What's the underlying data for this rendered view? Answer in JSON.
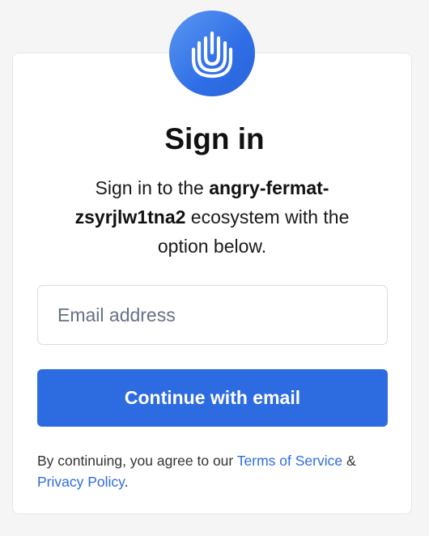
{
  "logo": {
    "icon": "hand-icon",
    "color": "#2f6fe6"
  },
  "title": "Sign in",
  "subtitle": {
    "prefix": "Sign in to the ",
    "ecosystem": "angry-fermat-zsyrjlw1tna2",
    "suffix": " ecosystem with the option below."
  },
  "email": {
    "placeholder": "Email address",
    "value": ""
  },
  "continue_button": {
    "label": "Continue with email",
    "color": "#2d6be0"
  },
  "legal": {
    "prefix": "By continuing, you agree to our ",
    "terms_label": "Terms of Service",
    "joiner": " & ",
    "privacy_label": "Privacy Policy",
    "suffix": "."
  }
}
